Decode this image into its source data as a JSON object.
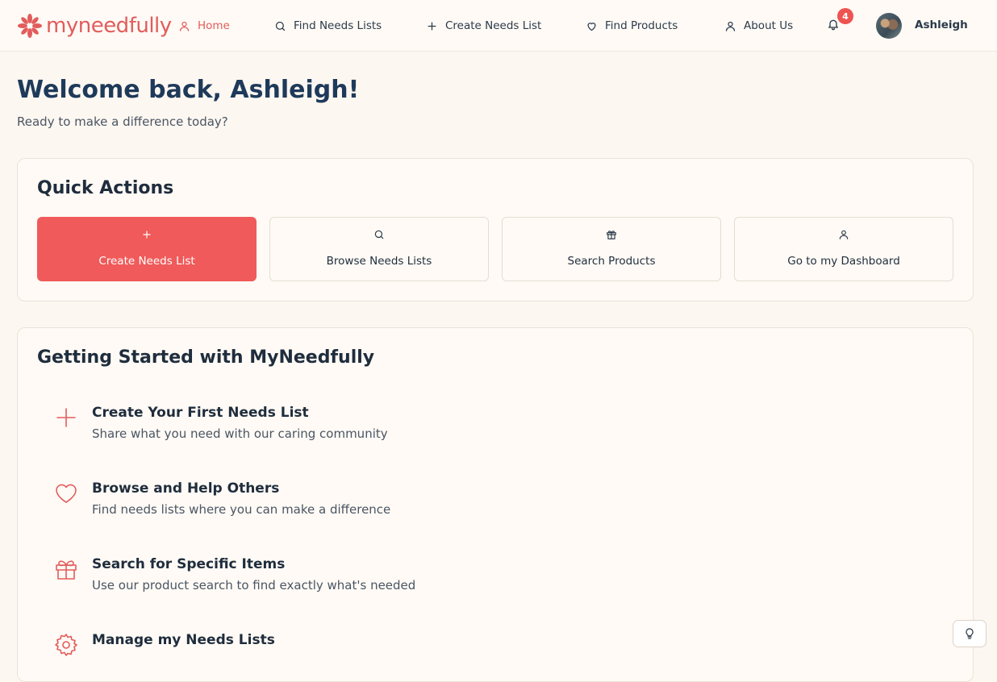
{
  "brand": {
    "name": "myneedfully",
    "accent": "#e25c5c",
    "primary_button": "#f05a5a",
    "heading": "#1e3a5a",
    "background": "#fdf7f1"
  },
  "nav": {
    "items": [
      {
        "label": "Home",
        "icon": "user-icon",
        "active": true
      },
      {
        "label": "Find Needs Lists",
        "icon": "search-icon",
        "active": false
      },
      {
        "label": "Create Needs List",
        "icon": "plus-icon",
        "active": false
      },
      {
        "label": "Find Products",
        "icon": "heart-icon",
        "active": false
      },
      {
        "label": "About Us",
        "icon": "user-icon",
        "active": false
      }
    ],
    "notifications_count": "4",
    "user_name": "Ashleigh"
  },
  "welcome": {
    "title": "Welcome back, Ashleigh!",
    "subtitle": "Ready to make a difference today?"
  },
  "quick_actions": {
    "title": "Quick Actions",
    "buttons": [
      {
        "label": "Create Needs List",
        "icon": "plus-icon",
        "primary": true
      },
      {
        "label": "Browse Needs Lists",
        "icon": "search-icon",
        "primary": false
      },
      {
        "label": "Search Products",
        "icon": "gift-icon",
        "primary": false
      },
      {
        "label": "Go to my Dashboard",
        "icon": "user-icon",
        "primary": false
      }
    ]
  },
  "getting_started": {
    "title": "Getting Started with MyNeedfully",
    "items": [
      {
        "title": "Create Your First Needs List",
        "description": "Share what you need with our caring community",
        "icon": "plus-icon"
      },
      {
        "title": "Browse and Help Others",
        "description": "Find needs lists where you can make a difference",
        "icon": "heart-icon"
      },
      {
        "title": "Search for Specific Items",
        "description": "Use our product search to find exactly what's needed",
        "icon": "gift-icon"
      },
      {
        "title": "Manage my Needs Lists",
        "description": "",
        "icon": "gear-icon"
      }
    ]
  },
  "help": {
    "icon": "lightbulb-icon"
  }
}
